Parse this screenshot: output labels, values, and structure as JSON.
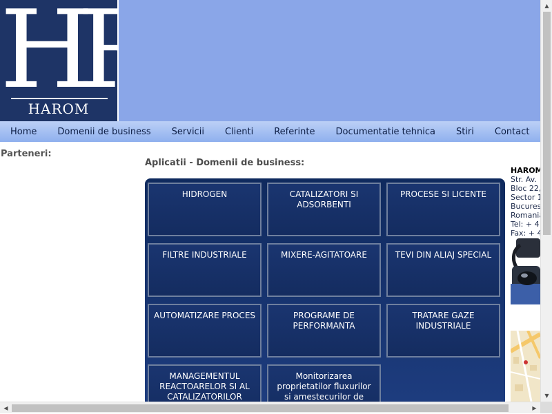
{
  "logo": {
    "monogram": "HR",
    "wordmark": "HAROM"
  },
  "nav": [
    {
      "label": "Home"
    },
    {
      "label": "Domenii de business"
    },
    {
      "label": "Servicii"
    },
    {
      "label": "Clienti"
    },
    {
      "label": "Referinte"
    },
    {
      "label": "Documentatie tehnica"
    },
    {
      "label": "Stiri"
    },
    {
      "label": "Contact"
    }
  ],
  "sidebar": {
    "partners_heading": "Parteneri:"
  },
  "main": {
    "title": "Aplicatii - Domenii de business:",
    "tiles": [
      {
        "label": "HIDROGEN"
      },
      {
        "label": "CATALIZATORI SI ADSORBENTI"
      },
      {
        "label": "PROCESE SI LICENTE"
      },
      {
        "label": "FILTRE INDUSTRIALE"
      },
      {
        "label": "MIXERE-AGITATOARE"
      },
      {
        "label": "TEVI DIN ALIAJ SPECIAL"
      },
      {
        "label": "AUTOMATIZARE PROCES"
      },
      {
        "label": "PROGRAME DE PERFORMANTA"
      },
      {
        "label": "TRATARE GAZE INDUSTRIALE"
      },
      {
        "label": "MANAGEMENTUL REACTOARELOR SI AL CATALIZATORILOR"
      },
      {
        "label": "Monitorizarea proprietatilor fluxurilor si amestecurilor de"
      }
    ]
  },
  "contact": {
    "lines": [
      "HAROM",
      "Str. Av.",
      "Bloc 22,",
      "Sector 1",
      "Bucures",
      "Romania",
      "Tel: + 4",
      "Fax: + 4"
    ]
  },
  "colors": {
    "logo_bg": "#1e3466",
    "banner_bg": "#8aa6e8",
    "panel_bg": "#0f2a5e",
    "nav_bg": "#a9c2f2"
  }
}
